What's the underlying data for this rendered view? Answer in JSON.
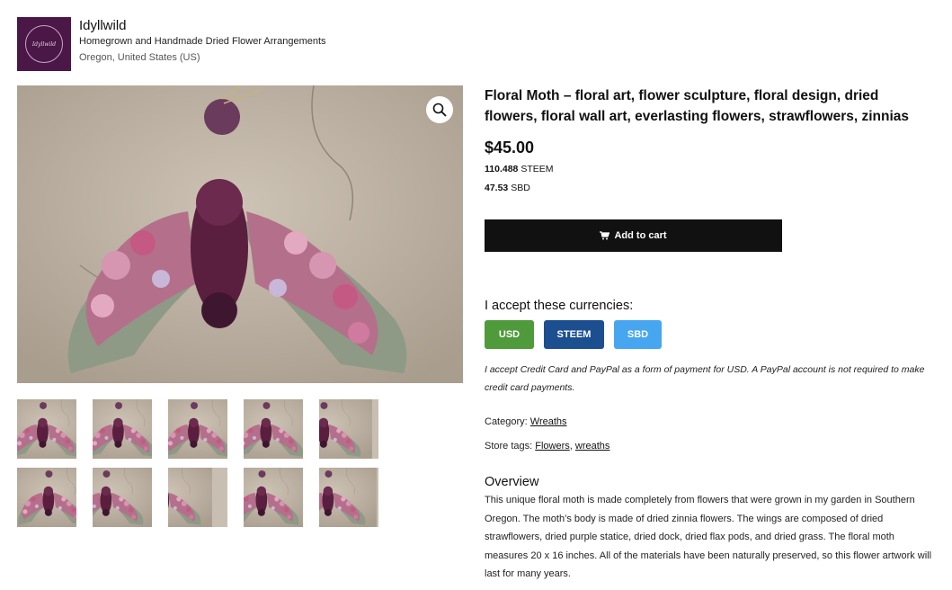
{
  "store": {
    "logo_text": "Idyllwild",
    "name": "Idyllwild",
    "tagline": "Homegrown and Handmade Dried Flower Arrangements",
    "location": "Oregon, United States (US)"
  },
  "product": {
    "title": "Floral Moth – floral art, flower sculpture, floral design, dried flowers, floral wall art, everlasting flowers, strawflowers, zinnias",
    "price_usd": "$45.00",
    "price_steem_value": "110.488",
    "price_steem_unit": "STEEM",
    "price_sbd_value": "47.53",
    "price_sbd_unit": "SBD",
    "add_to_cart_label": "Add to cart",
    "thumbnail_count": 10
  },
  "currencies": {
    "label": "I accept these currencies:",
    "options": [
      "USD",
      "STEEM",
      "SBD"
    ],
    "colors": {
      "USD": "#4f9a3b",
      "STEEM": "#1c4f8f",
      "SBD": "#47a6f0"
    },
    "note": "I accept Credit Card and PayPal as a form of payment for USD. A PayPal account is not required to make credit card payments."
  },
  "meta": {
    "category_label": "Category:",
    "category": "Wreaths",
    "tags_label": "Store tags:",
    "tag_1": "Flowers",
    "tag_sep": ",",
    "tag_2": "wreaths"
  },
  "overview": {
    "heading": "Overview",
    "text": "This unique floral moth is made completely from flowers that were grown in my garden in Southern Oregon. The moth’s body is made of dried zinnia flowers. The wings are composed of dried strawflowers, dried purple statice, dried dock, dried flax pods, and dried grass. The floral moth measures 20 x 16 inches. All of the materials have been naturally preserved, so this flower artwork will last for many years."
  },
  "icons": {
    "zoom": "magnifier-icon",
    "cart": "cart-icon",
    "logo": "wreath-icon"
  }
}
